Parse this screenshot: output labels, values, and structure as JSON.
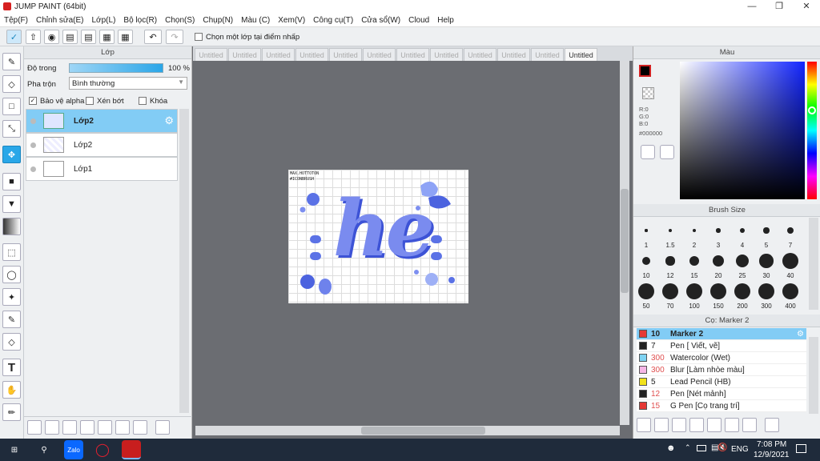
{
  "app": {
    "title": "JUMP PAINT (64bit)"
  },
  "menu": [
    "Tệp(F)",
    "Chỉnh sửa(E)",
    "Lớp(L)",
    "Bộ lọc(R)",
    "Chọn(S)",
    "Chụp(N)",
    "Màu (C)",
    "Xem(V)",
    "Công cụ(T)",
    "Cửa sổ(W)",
    "Cloud",
    "Help"
  ],
  "toolbar": {
    "select_layer_label": "Chọn một lớp tại điểm nhấp"
  },
  "layer_panel": {
    "title": "Lớp",
    "opacity_label": "Độ trong",
    "opacity_value": "100 %",
    "opacity_fraction": 1.0,
    "blend_label": "Pha trộn",
    "blend_value": "Bình thường",
    "protect_alpha_label": "Bảo vệ alpha",
    "clip_label": "Xén bớt",
    "lock_label": "Khóa",
    "layers": [
      {
        "name": "Lớp2"
      },
      {
        "name": "Lớp2"
      },
      {
        "name": "Lớp1"
      }
    ]
  },
  "tabs": [
    "Untitled",
    "Untitled",
    "Untitled",
    "Untitled",
    "Untitled",
    "Untitled",
    "Untitled",
    "Untitled",
    "Untitled",
    "Untitled",
    "Untitled",
    "Untitled"
  ],
  "color_panel": {
    "title": "Màu",
    "r": "R:0",
    "g": "G:0",
    "b": "B:0",
    "hex": "#000000"
  },
  "brush_size": {
    "title": "Brush Size",
    "sizes": [
      "1",
      "1.5",
      "2",
      "3",
      "4",
      "5",
      "7",
      "10",
      "12",
      "15",
      "20",
      "25",
      "30",
      "40",
      "50",
      "70",
      "100",
      "150",
      "200",
      "300",
      "400"
    ]
  },
  "tool_panel": {
    "title": "Cọ: Marker 2",
    "tools": [
      {
        "num": "10",
        "name": "Marker 2",
        "color": "#e53935"
      },
      {
        "num": "7",
        "name": "Pen [ Viết, vẽ]",
        "color": "#222222"
      },
      {
        "num": "300",
        "name": "Watercolor (Wet)",
        "color": "#7fd3f2"
      },
      {
        "num": "300",
        "name": "Blur [Làm nhòe màu]",
        "color": "#f6b6e6"
      },
      {
        "num": "5",
        "name": "Lead Pencil (HB)",
        "color": "#f2e21a"
      },
      {
        "num": "12",
        "name": "Pen [Nét mảnh]",
        "color": "#222222"
      },
      {
        "num": "15",
        "name": "G Pen [Cọ trang trí]",
        "color": "#e53935"
      }
    ]
  },
  "canvas_art": {
    "small_text_1": "MAX.HOTTOTON",
    "small_text_2": "#ICONBRUSH",
    "main_text": "he"
  },
  "taskbar": {
    "time": "7:08 PM",
    "date": "12/9/2021",
    "lang": "ENG",
    "app1": "Zalo"
  }
}
